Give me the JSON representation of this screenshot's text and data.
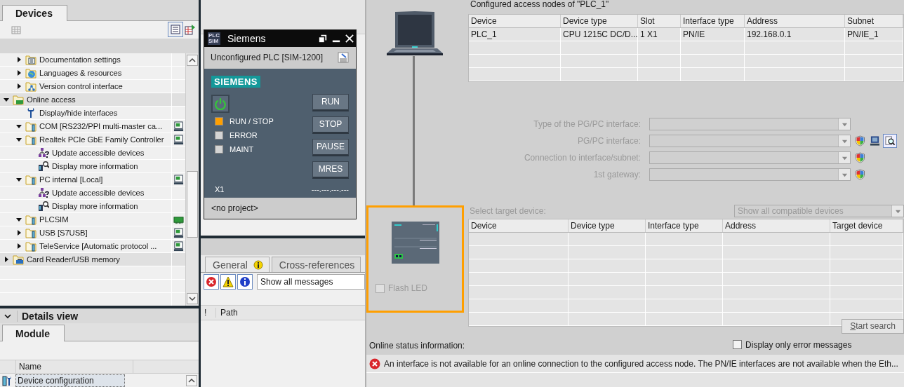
{
  "devices_panel": {
    "tabs": [
      {
        "label": "Devices",
        "selected": true
      }
    ],
    "tree": {
      "continued_items": [
        {
          "label": "Documentation settings",
          "kind": "docs",
          "expanded": false
        },
        {
          "label": "Languages & resources",
          "kind": "globe",
          "expanded": false
        },
        {
          "label": "Version control interface",
          "kind": "version",
          "expanded": false
        }
      ],
      "items": [
        {
          "label": "Online access",
          "kind": "online",
          "expanded": true,
          "children": [
            {
              "label": "Display/hide interfaces",
              "kind": "tool"
            },
            {
              "label": "COM [RS232/PPI multi-master ca...",
              "kind": "interface",
              "expanded": true,
              "adapter": {
                "kind": "pc"
              }
            },
            {
              "label": "Realtek PCIe GbE Family Controller",
              "kind": "interface",
              "expanded": true,
              "adapter": {
                "kind": "pc"
              },
              "children": [
                {
                  "label": "Update accessible devices",
                  "kind": "update"
                },
                {
                  "label": "Display more information",
                  "kind": "info"
                }
              ]
            },
            {
              "label": "PC internal [Local]",
              "kind": "interface",
              "expanded": true,
              "adapter": {
                "kind": "pc"
              },
              "children": [
                {
                  "label": "Update accessible devices",
                  "kind": "update"
                },
                {
                  "label": "Display more information",
                  "kind": "info"
                }
              ]
            },
            {
              "label": "PLCSIM",
              "kind": "interface",
              "expanded": true,
              "adapter": {
                "kind": "card"
              }
            },
            {
              "label": "USB [S7USB]",
              "kind": "interface",
              "expanded": false,
              "adapter": {
                "kind": "pc"
              }
            },
            {
              "label": "TeleService [Automatic protocol ...",
              "kind": "interface",
              "expanded": false,
              "adapter": {
                "kind": "pc"
              }
            }
          ]
        },
        {
          "label": "Card Reader/USB memory",
          "kind": "card-reader",
          "expanded": false
        }
      ]
    }
  },
  "details_view": {
    "title": "Details view",
    "expanded": true,
    "tabs": [
      {
        "label": "Module",
        "selected": true
      }
    ],
    "columns": [
      "Name"
    ],
    "rows": [
      {
        "name": "Device configuration",
        "selected": true
      }
    ]
  },
  "plcsim": {
    "badge": [
      "PLC",
      "SIM"
    ],
    "title": "Siemens",
    "cpu": "Unconfigured PLC [SIM-1200]",
    "brand": "SIEMENS",
    "power_on": true,
    "leds": [
      {
        "label": "RUN / STOP",
        "color": "#ff9f00"
      },
      {
        "label": "ERROR",
        "color": "#d4d4d4"
      },
      {
        "label": "MAINT",
        "color": "#d4d4d4"
      }
    ],
    "buttons": [
      "RUN",
      "STOP",
      "PAUSE",
      "MRES"
    ],
    "port": "X1",
    "ip": "---.---.---.---",
    "project": "<no project>"
  },
  "inspector": {
    "tabs": [
      {
        "label": "General",
        "selected": true,
        "info": true
      },
      {
        "label": "Cross-references",
        "selected": false
      }
    ],
    "filter": "Show all messages",
    "columns": [
      "!",
      "Path"
    ]
  },
  "online_access": {
    "plc_selected": true,
    "flash_led": {
      "label": "Flash LED",
      "checked": false,
      "disabled": true
    },
    "nodes_title": "Configured access nodes of \"PLC_1\"",
    "nodes_columns": [
      "Device",
      "Device type",
      "Slot",
      "Interface type",
      "Address",
      "Subnet"
    ],
    "nodes_rows": [
      [
        "PLC_1",
        "CPU 1215C DC/D...",
        "1 X1",
        "PN/IE",
        "192.168.0.1",
        "PN/IE_1"
      ]
    ],
    "form": [
      {
        "label": "Type of the PG/PC interface:",
        "kind": "plain",
        "disabled": true
      },
      {
        "label": "PG/PC interface:",
        "kind": "tools",
        "disabled": true
      },
      {
        "label": "Connection to interface/subnet:",
        "kind": "secure",
        "disabled": true
      },
      {
        "label": "1st gateway:",
        "kind": "secure",
        "disabled": true
      }
    ],
    "target_label": "Select target device:",
    "target_filter": "Show all compatible devices",
    "target_columns": [
      "Device",
      "Device type",
      "Interface type",
      "Address",
      "Target device"
    ],
    "start_search": "Start search",
    "status_label": "Online status information:",
    "only_errors": {
      "label": "Display only error messages",
      "checked": false
    },
    "messages": [
      {
        "kind": "error",
        "text": "An interface is not available for an online connection to the configured access node. The PN/IE interfaces are not available when the Eth..."
      }
    ]
  }
}
